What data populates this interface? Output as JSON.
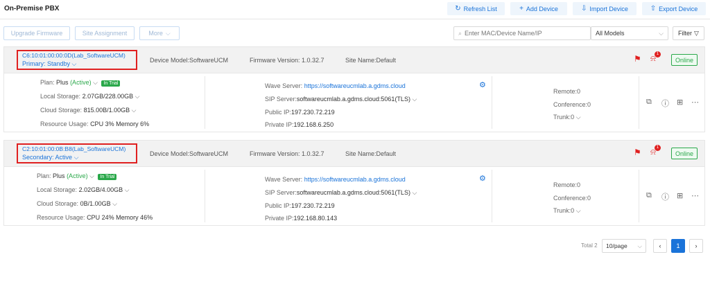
{
  "header": {
    "title": "On-Premise PBX",
    "refresh_label": "Refresh List",
    "add_label": "Add Device",
    "import_label": "Import Device",
    "export_label": "Export Device"
  },
  "toolbar": {
    "upgrade_label": "Upgrade Firmware",
    "site_label": "Site Assignment",
    "more_label": "More",
    "search_placeholder": "Enter MAC/Device Name/IP",
    "model_select": "All Models",
    "filter_label": "Filter"
  },
  "devices": [
    {
      "mac_name": "C6:10:01:00:00:0D(Lab_SoftwareUCM)",
      "role": "Primary: Standby",
      "model": "Device Model:SoftwareUCM",
      "firmware": "Firmware Version: 1.0.32.7",
      "site": "Site Name:Default",
      "alarm_count": "1",
      "status": "Online",
      "plan_label": "Plan:",
      "plan_value": "Plus",
      "plan_state": "(Active)",
      "trial": "In Trial",
      "local_label": "Local Storage:",
      "local_value": "2.07GB/228.00GB",
      "cloud_label": "Cloud Storage:",
      "cloud_value": "815.00B/1.00GB",
      "resource_label": "Resource Usage:",
      "resource_value": "CPU 3%  Memory 6%",
      "wave_label": "Wave Server:",
      "wave_value": "https://softwareucmlab.a.gdms.cloud",
      "sip_label": "SIP Server:",
      "sip_value": "softwareucmlab.a.gdms.cloud:5061(TLS)",
      "public_label": "Public IP:",
      "public_value": "197.230.72.219",
      "private_label": "Private IP:",
      "private_value": "192.168.6.250",
      "remote": "Remote:0",
      "conference": "Conference:0",
      "trunk": "Trunk:0"
    },
    {
      "mac_name": "C2:10:01:00:0B:B8(Lab_SoftwareUCM)",
      "role": "Secondary: Active",
      "model": "Device Model:SoftwareUCM",
      "firmware": "Firmware Version: 1.0.32.7",
      "site": "Site Name:Default",
      "alarm_count": "1",
      "status": "Online",
      "plan_label": "Plan:",
      "plan_value": "Plus",
      "plan_state": "(Active)",
      "trial": "In Trial",
      "local_label": "Local Storage:",
      "local_value": "2.02GB/4.00GB",
      "cloud_label": "Cloud Storage:",
      "cloud_value": "0B/1.00GB",
      "resource_label": "Resource Usage:",
      "resource_value": "CPU 24%  Memory 46%",
      "wave_label": "Wave Server:",
      "wave_value": "https://softwareucmlab.a.gdms.cloud",
      "sip_label": "SIP Server:",
      "sip_value": "softwareucmlab.a.gdms.cloud:5061(TLS)",
      "public_label": "Public IP:",
      "public_value": "197.230.72.219",
      "private_label": "Private IP:",
      "private_value": "192.168.80.143",
      "remote": "Remote:0",
      "conference": "Conference:0",
      "trunk": "Trunk:0"
    }
  ],
  "pagination": {
    "total": "Total 2",
    "page_size": "10/page",
    "current_page": "1"
  },
  "colors": {
    "accent": "#1a73d9",
    "online": "#2aa84a",
    "alert": "#e02020"
  }
}
